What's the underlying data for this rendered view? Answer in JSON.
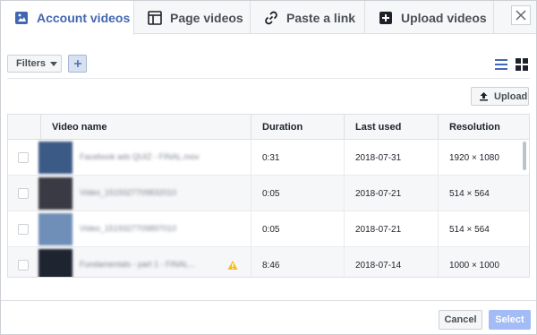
{
  "tabs": [
    {
      "label": "Account videos",
      "icon": "account-video-icon",
      "active": true
    },
    {
      "label": "Page videos",
      "icon": "page-video-icon",
      "active": false
    },
    {
      "label": "Paste a link",
      "icon": "link-icon",
      "active": false
    },
    {
      "label": "Upload videos",
      "icon": "upload-video-icon",
      "active": false
    }
  ],
  "toolbar": {
    "filters_label": "Filters",
    "upload_label": "Upload"
  },
  "table": {
    "headers": [
      "Video name",
      "Duration",
      "Last used",
      "Resolution"
    ],
    "rows": [
      {
        "name": "Facebook ads QUIZ - FINAL.mov",
        "duration": "0:31",
        "last_used": "2018-07-31",
        "resolution": "1920 × 1080"
      },
      {
        "name": "Video_1519327709832010",
        "duration": "0:05",
        "last_used": "2018-07-21",
        "resolution": "514 × 564"
      },
      {
        "name": "Video_1519327709897010",
        "duration": "0:05",
        "last_used": "2018-07-21",
        "resolution": "514 × 564"
      },
      {
        "name": "Fundamentals - part 1 - FINAL...",
        "duration": "8:46",
        "last_used": "2018-07-14",
        "resolution": "1000 × 1000"
      }
    ]
  },
  "footer": {
    "cancel_label": "Cancel",
    "select_label": "Select"
  },
  "colors": {
    "accent": "#4267b2",
    "select_disabled": "#a3bcf5",
    "warning": "#f7b928"
  }
}
